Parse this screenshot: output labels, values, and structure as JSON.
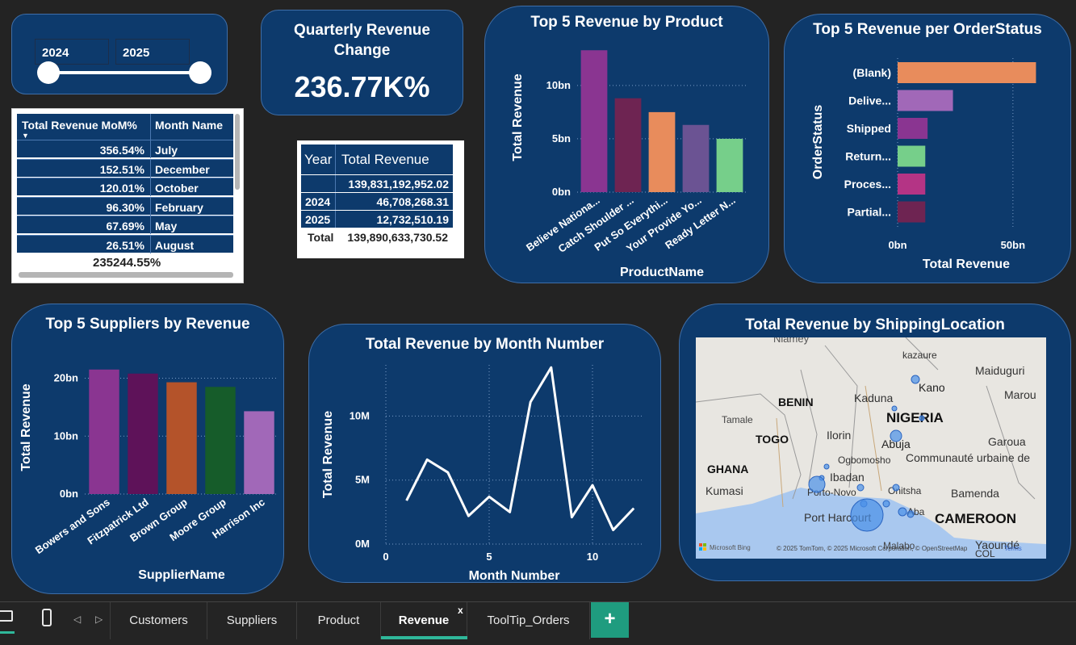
{
  "slicer": {
    "start_year": "2024",
    "end_year": "2025"
  },
  "kpi": {
    "title_line1": "Quarterly Revenue",
    "title_line2": "Change",
    "value": "236.77K%"
  },
  "mom_table": {
    "col1": "Total Revenue MoM%",
    "col2": "Month Name",
    "rows": [
      {
        "pct": "356.54%",
        "month": "July"
      },
      {
        "pct": "152.51%",
        "month": "December"
      },
      {
        "pct": "120.01%",
        "month": "October"
      },
      {
        "pct": "96.30%",
        "month": "February"
      },
      {
        "pct": "67.69%",
        "month": "May"
      },
      {
        "pct": "26.51%",
        "month": "August"
      }
    ],
    "total": "235244.55%"
  },
  "year_table": {
    "col1": "Year",
    "col2": "Total Revenue",
    "rows": [
      {
        "year": "",
        "revenue": "139,831,192,952.02"
      },
      {
        "year": "2024",
        "revenue": "46,708,268.31"
      },
      {
        "year": "2025",
        "revenue": "12,732,510.19"
      }
    ],
    "total_label": "Total",
    "total_value": "139,890,633,730.52"
  },
  "chart_data": [
    {
      "type": "bar",
      "title": "Top 5 Revenue by Product",
      "xlabel": "ProductName",
      "ylabel": "Total Revenue",
      "categories": [
        "Believe Nationa...",
        "Catch Shoulder ...",
        "Put So Everythi...",
        "Your Provide Yo...",
        "Ready Letter N..."
      ],
      "values": [
        13.3,
        8.8,
        7.5,
        6.3,
        5.0
      ],
      "colors": [
        "#8a3591",
        "#6e2452",
        "#e88c5c",
        "#6b5393",
        "#76cf8a"
      ],
      "yticks": [
        "0bn",
        "5bn",
        "10bn"
      ],
      "ylim": [
        0,
        14
      ]
    },
    {
      "type": "bar",
      "orientation": "horizontal",
      "title": "Top 5 Revenue per OrderStatus",
      "xlabel": "Total Revenue",
      "ylabel": "OrderStatus",
      "categories": [
        "(Blank)",
        "Delive...",
        "Shipped",
        "Return...",
        "Proces...",
        "Partial..."
      ],
      "values": [
        60,
        24,
        13,
        12,
        12,
        12
      ],
      "colors": [
        "#e88c5c",
        "#a168b8",
        "#8a3591",
        "#76cf8a",
        "#b43485",
        "#6e2452"
      ],
      "xticks": [
        "0bn",
        "50bn"
      ],
      "xlim": [
        0,
        70
      ]
    },
    {
      "type": "bar",
      "title": "Top 5 Suppliers by Revenue",
      "xlabel": "SupplierName",
      "ylabel": "Total Revenue",
      "categories": [
        "Bowers and Sons",
        "Fitzpatrick Ltd",
        "Brown Group",
        "Moore Group",
        "Harrison Inc"
      ],
      "values": [
        21.5,
        20.8,
        19.3,
        18.5,
        14.3
      ],
      "colors": [
        "#8a3591",
        "#5e1259",
        "#b4532a",
        "#165c2a",
        "#a168b8"
      ],
      "yticks": [
        "0bn",
        "10bn",
        "20bn"
      ],
      "ylim": [
        0,
        23
      ]
    },
    {
      "type": "line",
      "title": "Total Revenue by Month Number",
      "xlabel": "Month Number",
      "ylabel": "Total Revenue",
      "x": [
        1,
        2,
        3,
        4,
        5,
        6,
        7,
        8,
        9,
        10,
        11,
        12
      ],
      "y": [
        3.4,
        6.6,
        5.6,
        2.2,
        3.7,
        2.5,
        11.1,
        13.8,
        2.1,
        4.6,
        1.1,
        2.8
      ],
      "xticks": [
        "0",
        "5",
        "10"
      ],
      "yticks": [
        "0M",
        "5M",
        "10M"
      ],
      "ylim": [
        0,
        14
      ],
      "color": "#ffffff"
    }
  ],
  "map": {
    "title": "Total Revenue by ShippingLocation",
    "countries": [
      "BENIN",
      "TOGO",
      "GHANA",
      "NIGERIA",
      "CAMEROON"
    ],
    "places": [
      "Niamey",
      "kazaure",
      "Kano",
      "Maiduguri",
      "Maroua",
      "Kaduna",
      "Tamale",
      "Ilorin",
      "Abuja",
      "Garoua",
      "Ogbomosho",
      "Communauté urbaine de",
      "Ibadan",
      "Kumasi",
      "Porto-Novo",
      "Onitsha",
      "Bamenda",
      "Port Harcourt",
      "Aba",
      "Malabo",
      "Yaoundé",
      "COL"
    ],
    "copyright": "© 2025 TomTom, © 2025 Microsoft Corporation, © OpenStreetMap",
    "terms": "Terms",
    "brand": "Microsoft Bing"
  },
  "tabs": {
    "pages": [
      "Customers",
      "Suppliers",
      "Product",
      "Revenue",
      "ToolTip_Orders"
    ],
    "active": "Revenue",
    "close_glyph": "x",
    "add_glyph": "+"
  },
  "colors": {
    "card": "#0d3a6c",
    "card_border": "#3e6ea8",
    "background": "#232323",
    "active_tab_underline": "#2fb89a",
    "add_button": "#1f9c7f"
  }
}
